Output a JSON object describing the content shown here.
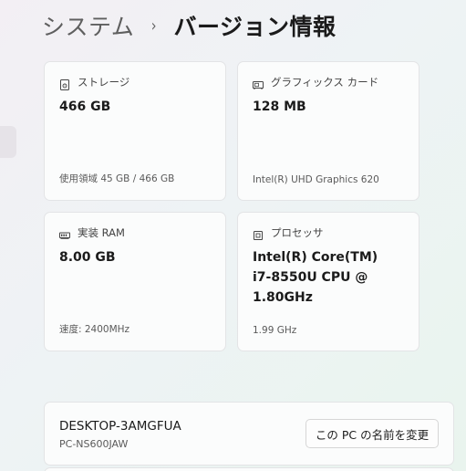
{
  "breadcrumb": {
    "parent": "システム",
    "separator": "›",
    "current": "バージョン情報"
  },
  "cards": {
    "storage": {
      "icon": "storage-icon",
      "label": "ストレージ",
      "value": "466 GB",
      "sub": "使用領域 45 GB / 466 GB"
    },
    "gpu": {
      "icon": "graphics-card-icon",
      "label": "グラフィックス カード",
      "value": "128 MB",
      "sub": "Intel(R) UHD Graphics 620"
    },
    "ram": {
      "icon": "ram-icon",
      "label": "実装 RAM",
      "value": "8.00 GB",
      "sub": "速度: 2400MHz"
    },
    "cpu": {
      "icon": "processor-icon",
      "label": "プロセッサ",
      "value_lines": [
        "Intel(R) Core(TM)",
        "i7-8550U CPU @",
        "1.80GHz"
      ],
      "sub": "1.99 GHz"
    }
  },
  "device": {
    "name": "DESKTOP-3AMGFUA",
    "model": "PC-NS600JAW",
    "rename_label": "この PC の名前を変更"
  }
}
